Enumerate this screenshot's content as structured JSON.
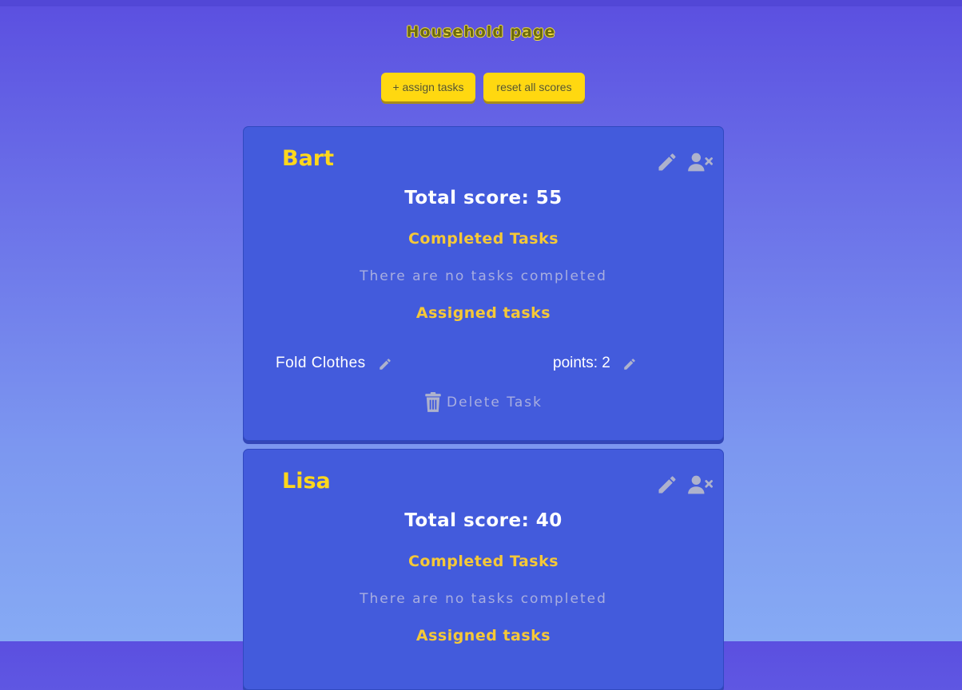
{
  "page": {
    "title": "Household page"
  },
  "actions": {
    "assign_label": "+ assign tasks",
    "reset_label": "reset all scores"
  },
  "members": [
    {
      "name": "Bart",
      "total_score_label": "Total score: 55",
      "completed_heading": "Completed Tasks",
      "completed_empty": "There are no tasks completed",
      "assigned_heading": "Assigned tasks",
      "tasks": [
        {
          "name": "Fold Clothes",
          "points_label": "points: 2",
          "delete_label": "Delete Task"
        }
      ]
    },
    {
      "name": "Lisa",
      "total_score_label": "Total score: 40",
      "completed_heading": "Completed Tasks",
      "completed_empty": "There are no tasks completed",
      "assigned_heading": "Assigned tasks"
    }
  ],
  "icons": {
    "edit": "pencil-icon",
    "remove_member": "user-remove-icon",
    "delete": "trash-icon"
  },
  "colors": {
    "accent_yellow": "#ffd810",
    "card_blue": "#435bdc",
    "heading_gold": "#f5c838"
  }
}
